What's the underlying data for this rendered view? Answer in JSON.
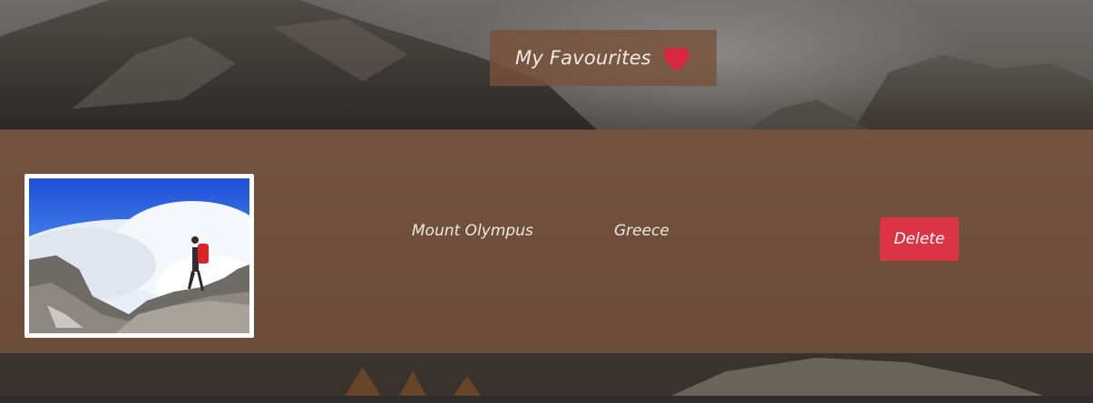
{
  "header": {
    "title": "My Favourites",
    "title_icon": "heart-icon"
  },
  "favourites": [
    {
      "image_alt": "hiker-on-mountain-above-clouds",
      "name": "Mount Olympus",
      "country": "Greece",
      "delete_label": "Delete"
    }
  ],
  "colors": {
    "heart": "#d7263d",
    "delete_button": "#db3446",
    "band": "#78543e"
  }
}
